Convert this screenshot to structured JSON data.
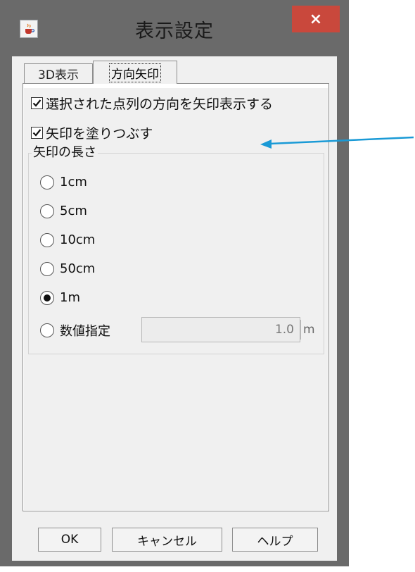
{
  "window": {
    "title": "表示設定",
    "close_label": "×",
    "app_icon": "java-cup-icon"
  },
  "tabs": [
    {
      "label": "3D表示",
      "selected": false
    },
    {
      "label": "方向矢印",
      "selected": true
    }
  ],
  "options": {
    "show_direction_label": "選択された点列の方向を矢印表示する",
    "show_direction_checked": true,
    "fill_arrow_label": "矢印を塗りつぶす",
    "fill_arrow_checked": true
  },
  "length_group": {
    "label": "矢印の長さ",
    "choices": [
      {
        "label": "1cm",
        "selected": false
      },
      {
        "label": "5cm",
        "selected": false
      },
      {
        "label": "10cm",
        "selected": false
      },
      {
        "label": "50cm",
        "selected": false
      },
      {
        "label": "1m",
        "selected": true
      },
      {
        "label": "数値指定",
        "selected": false
      }
    ],
    "custom_value": "1.0",
    "custom_unit": "m"
  },
  "buttons": {
    "ok": "OK",
    "cancel": "キャンセル",
    "help": "ヘルプ"
  },
  "colors": {
    "close_button": "#c9483c",
    "annotation_arrow": "#1a9ad6"
  }
}
